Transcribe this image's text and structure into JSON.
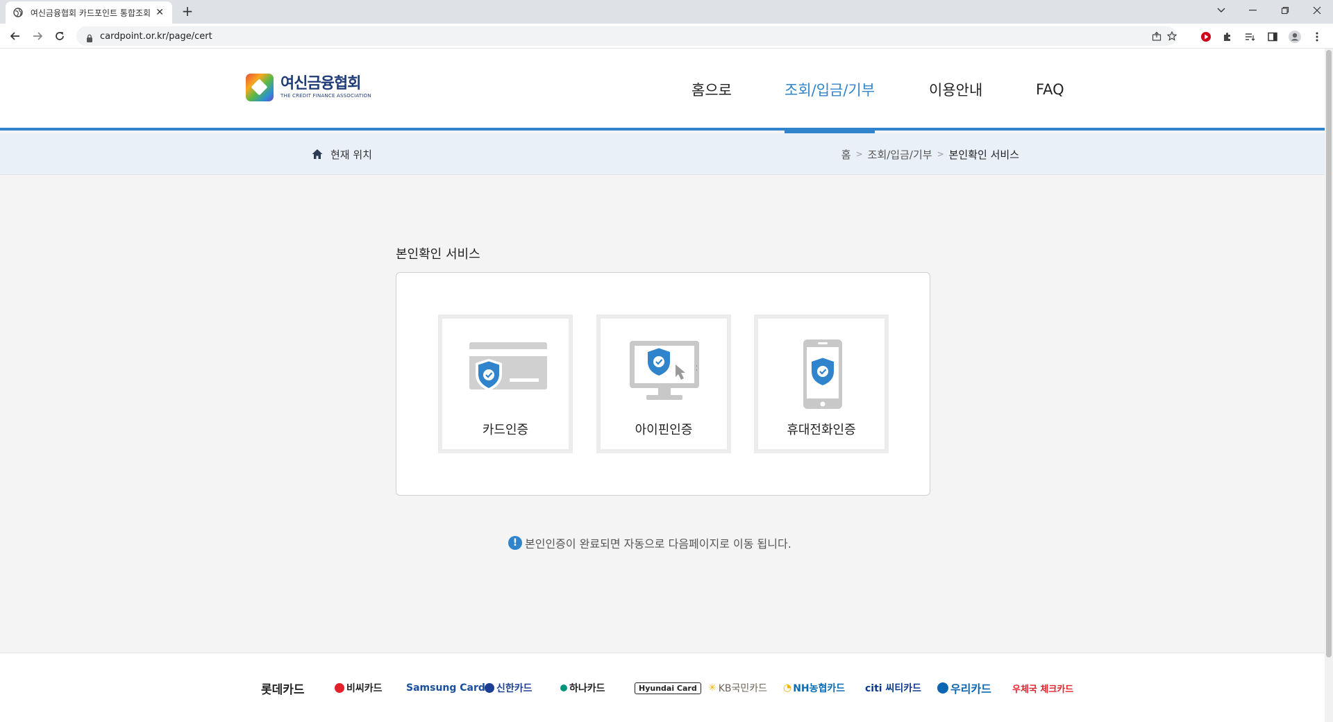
{
  "browser": {
    "tab_title": "여신금융협회 카드포인트 통합조회",
    "url": "cardpoint.or.kr/page/cert"
  },
  "header": {
    "logo_ko": "여신금융협회",
    "logo_en": "THE CREDIT FINANCE ASSOCIATION",
    "nav": [
      "홈으로",
      "조회/입금/기부",
      "이용안내",
      "FAQ"
    ]
  },
  "location": {
    "label": "현재 위치",
    "breadcrumb": [
      "홈",
      "조회/입금/기부",
      "본인확인 서비스"
    ]
  },
  "main": {
    "title": "본인확인 서비스",
    "options": [
      {
        "label": "카드인증",
        "icon": "credit-card-shield-icon"
      },
      {
        "label": "아이핀인증",
        "icon": "monitor-shield-icon"
      },
      {
        "label": "휴대전화인증",
        "icon": "phone-shield-icon"
      }
    ],
    "notice": "본인인증이 완료되면 자동으로 다음페이지로 이동 됩니다."
  },
  "footer": {
    "brands": [
      "롯데카드",
      "비씨카드",
      "Samsung Card",
      "신한카드",
      "하나카드",
      "Hyundai Card",
      "KB국민카드",
      "NH농협카드",
      "citi 씨티카드",
      "우리카드",
      "우체국 체크카드"
    ]
  },
  "colors": {
    "accent": "#2f84cc",
    "location_bg": "#eaf0f7",
    "page_bg": "#f4f4f4"
  }
}
